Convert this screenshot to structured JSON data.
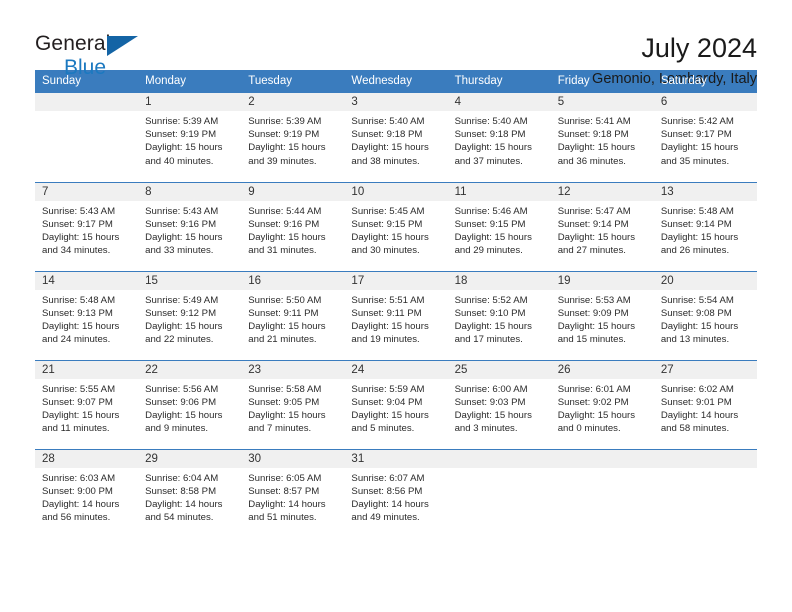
{
  "logo": {
    "word1": "General",
    "word2": "Blue",
    "triangle_color": "#1464a5",
    "blue_color": "#1c79c0"
  },
  "header": {
    "title": "July 2024",
    "subtitle": "Gemonio, Lombardy, Italy"
  },
  "theme": {
    "header_bg": "#3a7cbe",
    "daynum_bg": "#f0f0f0",
    "separator": "#3a7cbe"
  },
  "weekday_headers": [
    "Sunday",
    "Monday",
    "Tuesday",
    "Wednesday",
    "Thursday",
    "Friday",
    "Saturday"
  ],
  "weeks": [
    [
      {
        "day": "",
        "blank": true,
        "sunrise": "",
        "sunset": "",
        "daylight": ""
      },
      {
        "day": "1",
        "sunrise": "Sunrise: 5:39 AM",
        "sunset": "Sunset: 9:19 PM",
        "daylight": "Daylight: 15 hours and 40 minutes."
      },
      {
        "day": "2",
        "sunrise": "Sunrise: 5:39 AM",
        "sunset": "Sunset: 9:19 PM",
        "daylight": "Daylight: 15 hours and 39 minutes."
      },
      {
        "day": "3",
        "sunrise": "Sunrise: 5:40 AM",
        "sunset": "Sunset: 9:18 PM",
        "daylight": "Daylight: 15 hours and 38 minutes."
      },
      {
        "day": "4",
        "sunrise": "Sunrise: 5:40 AM",
        "sunset": "Sunset: 9:18 PM",
        "daylight": "Daylight: 15 hours and 37 minutes."
      },
      {
        "day": "5",
        "sunrise": "Sunrise: 5:41 AM",
        "sunset": "Sunset: 9:18 PM",
        "daylight": "Daylight: 15 hours and 36 minutes."
      },
      {
        "day": "6",
        "sunrise": "Sunrise: 5:42 AM",
        "sunset": "Sunset: 9:17 PM",
        "daylight": "Daylight: 15 hours and 35 minutes."
      }
    ],
    [
      {
        "day": "7",
        "sunrise": "Sunrise: 5:43 AM",
        "sunset": "Sunset: 9:17 PM",
        "daylight": "Daylight: 15 hours and 34 minutes."
      },
      {
        "day": "8",
        "sunrise": "Sunrise: 5:43 AM",
        "sunset": "Sunset: 9:16 PM",
        "daylight": "Daylight: 15 hours and 33 minutes."
      },
      {
        "day": "9",
        "sunrise": "Sunrise: 5:44 AM",
        "sunset": "Sunset: 9:16 PM",
        "daylight": "Daylight: 15 hours and 31 minutes."
      },
      {
        "day": "10",
        "sunrise": "Sunrise: 5:45 AM",
        "sunset": "Sunset: 9:15 PM",
        "daylight": "Daylight: 15 hours and 30 minutes."
      },
      {
        "day": "11",
        "sunrise": "Sunrise: 5:46 AM",
        "sunset": "Sunset: 9:15 PM",
        "daylight": "Daylight: 15 hours and 29 minutes."
      },
      {
        "day": "12",
        "sunrise": "Sunrise: 5:47 AM",
        "sunset": "Sunset: 9:14 PM",
        "daylight": "Daylight: 15 hours and 27 minutes."
      },
      {
        "day": "13",
        "sunrise": "Sunrise: 5:48 AM",
        "sunset": "Sunset: 9:14 PM",
        "daylight": "Daylight: 15 hours and 26 minutes."
      }
    ],
    [
      {
        "day": "14",
        "sunrise": "Sunrise: 5:48 AM",
        "sunset": "Sunset: 9:13 PM",
        "daylight": "Daylight: 15 hours and 24 minutes."
      },
      {
        "day": "15",
        "sunrise": "Sunrise: 5:49 AM",
        "sunset": "Sunset: 9:12 PM",
        "daylight": "Daylight: 15 hours and 22 minutes."
      },
      {
        "day": "16",
        "sunrise": "Sunrise: 5:50 AM",
        "sunset": "Sunset: 9:11 PM",
        "daylight": "Daylight: 15 hours and 21 minutes."
      },
      {
        "day": "17",
        "sunrise": "Sunrise: 5:51 AM",
        "sunset": "Sunset: 9:11 PM",
        "daylight": "Daylight: 15 hours and 19 minutes."
      },
      {
        "day": "18",
        "sunrise": "Sunrise: 5:52 AM",
        "sunset": "Sunset: 9:10 PM",
        "daylight": "Daylight: 15 hours and 17 minutes."
      },
      {
        "day": "19",
        "sunrise": "Sunrise: 5:53 AM",
        "sunset": "Sunset: 9:09 PM",
        "daylight": "Daylight: 15 hours and 15 minutes."
      },
      {
        "day": "20",
        "sunrise": "Sunrise: 5:54 AM",
        "sunset": "Sunset: 9:08 PM",
        "daylight": "Daylight: 15 hours and 13 minutes."
      }
    ],
    [
      {
        "day": "21",
        "sunrise": "Sunrise: 5:55 AM",
        "sunset": "Sunset: 9:07 PM",
        "daylight": "Daylight: 15 hours and 11 minutes."
      },
      {
        "day": "22",
        "sunrise": "Sunrise: 5:56 AM",
        "sunset": "Sunset: 9:06 PM",
        "daylight": "Daylight: 15 hours and 9 minutes."
      },
      {
        "day": "23",
        "sunrise": "Sunrise: 5:58 AM",
        "sunset": "Sunset: 9:05 PM",
        "daylight": "Daylight: 15 hours and 7 minutes."
      },
      {
        "day": "24",
        "sunrise": "Sunrise: 5:59 AM",
        "sunset": "Sunset: 9:04 PM",
        "daylight": "Daylight: 15 hours and 5 minutes."
      },
      {
        "day": "25",
        "sunrise": "Sunrise: 6:00 AM",
        "sunset": "Sunset: 9:03 PM",
        "daylight": "Daylight: 15 hours and 3 minutes."
      },
      {
        "day": "26",
        "sunrise": "Sunrise: 6:01 AM",
        "sunset": "Sunset: 9:02 PM",
        "daylight": "Daylight: 15 hours and 0 minutes."
      },
      {
        "day": "27",
        "sunrise": "Sunrise: 6:02 AM",
        "sunset": "Sunset: 9:01 PM",
        "daylight": "Daylight: 14 hours and 58 minutes."
      }
    ],
    [
      {
        "day": "28",
        "sunrise": "Sunrise: 6:03 AM",
        "sunset": "Sunset: 9:00 PM",
        "daylight": "Daylight: 14 hours and 56 minutes."
      },
      {
        "day": "29",
        "sunrise": "Sunrise: 6:04 AM",
        "sunset": "Sunset: 8:58 PM",
        "daylight": "Daylight: 14 hours and 54 minutes."
      },
      {
        "day": "30",
        "sunrise": "Sunrise: 6:05 AM",
        "sunset": "Sunset: 8:57 PM",
        "daylight": "Daylight: 14 hours and 51 minutes."
      },
      {
        "day": "31",
        "sunrise": "Sunrise: 6:07 AM",
        "sunset": "Sunset: 8:56 PM",
        "daylight": "Daylight: 14 hours and 49 minutes."
      },
      {
        "day": "",
        "blank": true,
        "sunrise": "",
        "sunset": "",
        "daylight": ""
      },
      {
        "day": "",
        "blank": true,
        "sunrise": "",
        "sunset": "",
        "daylight": ""
      },
      {
        "day": "",
        "blank": true,
        "sunrise": "",
        "sunset": "",
        "daylight": ""
      }
    ]
  ]
}
